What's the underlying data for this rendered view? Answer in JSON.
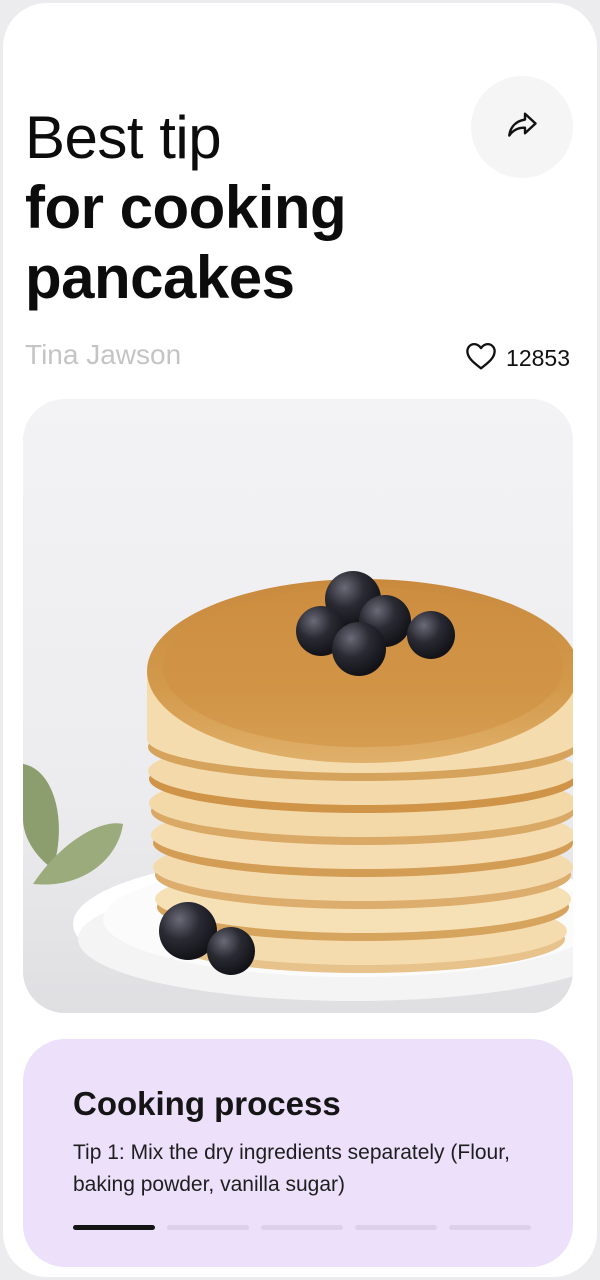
{
  "post": {
    "title_line1": "Best tip",
    "title_line2": "for cooking",
    "title_line3": "pancakes",
    "author": "Tina Jawson",
    "likes": "12853"
  },
  "icons": {
    "share": "share-arrow-icon",
    "like": "heart-outline-icon"
  },
  "hero_image": {
    "subject": "stack-of-pancakes-with-blueberries"
  },
  "process": {
    "title": "Cooking process",
    "tip": "Tip 1: Mix the dry ingredients separately (Flour, baking powder, vanilla sugar)",
    "steps_total": 5,
    "current_step": 1
  },
  "colors": {
    "card_bg": "#ece0fb",
    "progress_active": "#141414",
    "progress_inactive": "#dcd0ea",
    "author_text": "#c4c4c4"
  }
}
